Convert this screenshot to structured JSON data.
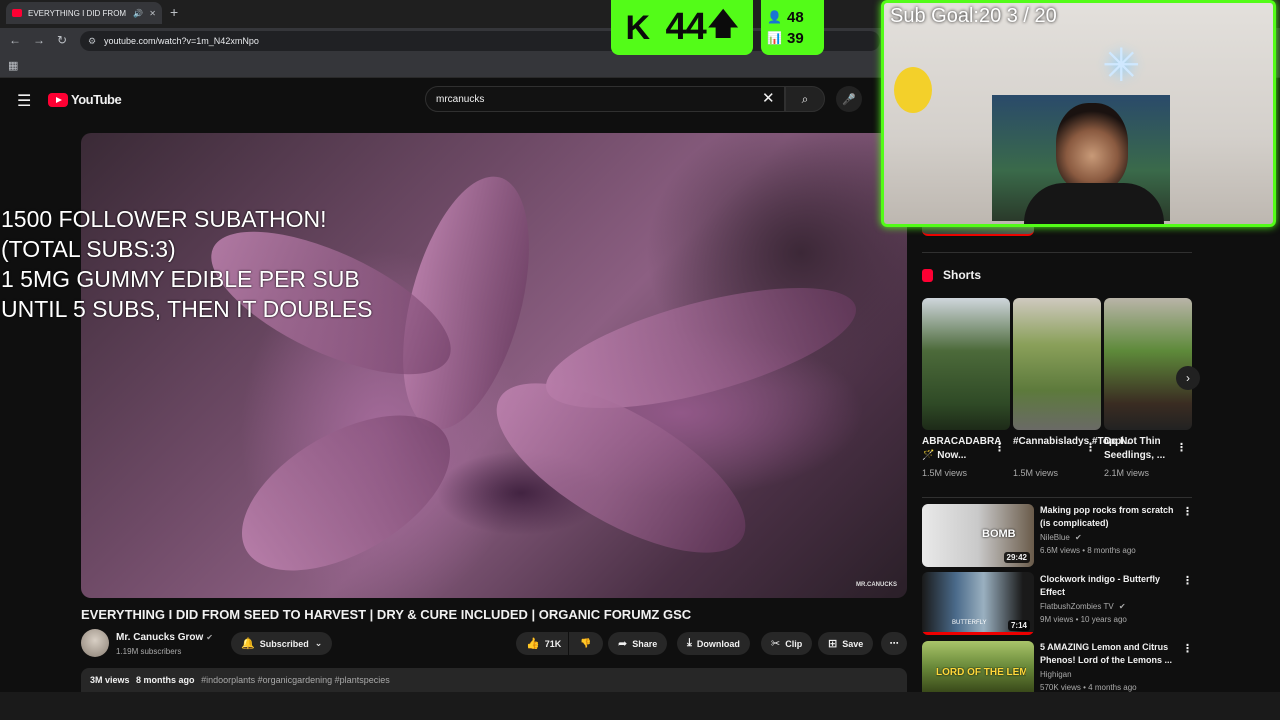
{
  "browser": {
    "tab_title": "EVERYTHING I DID FROM S",
    "url": "youtube.com/watch?v=1m_N42xmNpo"
  },
  "youtube": {
    "logo_text": "YouTube",
    "search_query": "mrcanucks"
  },
  "overlay": {
    "line1": "1500 FOLLOWER SUBATHON!",
    "line2": "(TOTAL SUBS:3)",
    "line3": "1 5MG GUMMY EDIBLE PER SUB",
    "line4": "UNTIL 5 SUBS, THEN IT DOUBLES"
  },
  "video": {
    "title": "EVERYTHING I DID FROM SEED TO HARVEST | DRY & CURE INCLUDED | ORGANIC FORUMZ GSC",
    "watermark": "MR.CANUCKS",
    "channel_name": "Mr. Canucks Grow",
    "channel_subs": "1.19M subscribers",
    "subscribed_label": "Subscribed",
    "likes": "71K",
    "share_label": "Share",
    "download_label": "Download",
    "clip_label": "Clip",
    "save_label": "Save",
    "views": "3M views",
    "age": "8 months ago",
    "hashtags": "#indoorplants #organicgardening #plantspecies"
  },
  "sidebar": {
    "shorts_heading": "Shorts",
    "shorts": [
      {
        "title": "ABRACADABRA 🪄 Now...",
        "views": "1.5M views"
      },
      {
        "title": "#Cannabisladys,#Toppi...",
        "views": "1.5M views"
      },
      {
        "title": "Do Not Thin Seedlings, ...",
        "views": "2.1M views"
      }
    ],
    "recommended": [
      {
        "title": "Making pop rocks from scratch (is complicated)",
        "channel": "NileBlue",
        "meta": "6.6M views • 8 months ago",
        "duration": "29:42",
        "thumb_text": "BOMB"
      },
      {
        "title": "Clockwork indigo - Butterfly Effect",
        "channel": "FlatbushZombies TV",
        "meta": "9M views • 10 years ago",
        "duration": "7:14",
        "thumb_text": "BUTTERFLY"
      },
      {
        "title": "5 AMAZING Lemon and Citrus Phenos! Lord of the Lemons ...",
        "channel": "Highigan",
        "meta": "570K views • 4 months ago",
        "duration": "",
        "thumb_text": "LORD OF THE LEMONS"
      }
    ]
  },
  "stream": {
    "kick_count": "44",
    "stat1": "48",
    "stat2": "39",
    "sub_goal": "Sub Goal:20  3 / 20"
  },
  "colors": {
    "kick_green": "#53fc18",
    "yt_red": "#ff0033",
    "bg": "#0f0f0f"
  }
}
